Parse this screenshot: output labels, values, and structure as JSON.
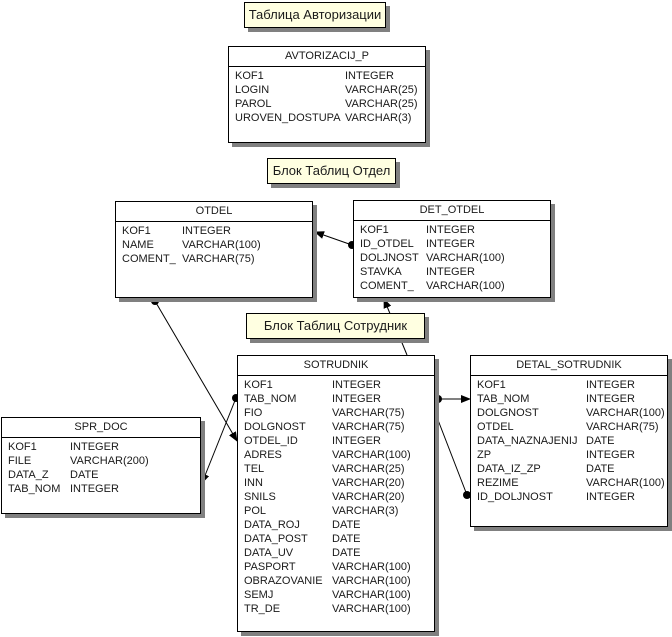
{
  "notes": {
    "auth": "Таблица Авторизации",
    "otdel": "Блок Таблиц Отдел",
    "sotrudnik": "Блок Таблиц Сотрудник"
  },
  "entities": {
    "avtorizacij_p": {
      "name": "AVTORIZACIJ_P",
      "columns": [
        {
          "name": "KOF1",
          "type": "INTEGER"
        },
        {
          "name": "LOGIN",
          "type": "VARCHAR(25)"
        },
        {
          "name": "PAROL",
          "type": "VARCHAR(25)"
        },
        {
          "name": "UROVEN_DOSTUPA",
          "type": "VARCHAR(3)"
        }
      ]
    },
    "otdel": {
      "name": "OTDEL",
      "columns": [
        {
          "name": "KOF1",
          "type": "INTEGER"
        },
        {
          "name": "NAME",
          "type": "VARCHAR(100)"
        },
        {
          "name": "COMENT_",
          "type": "VARCHAR(75)"
        }
      ]
    },
    "det_otdel": {
      "name": "DET_OTDEL",
      "columns": [
        {
          "name": "KOF1",
          "type": "INTEGER"
        },
        {
          "name": "ID_OTDEL",
          "type": "INTEGER"
        },
        {
          "name": "DOLJNOST",
          "type": "VARCHAR(100)"
        },
        {
          "name": "STAVKA",
          "type": "INTEGER"
        },
        {
          "name": "COMENT_",
          "type": "VARCHAR(100)"
        }
      ]
    },
    "sotrudnik": {
      "name": "SOTRUDNIK",
      "columns": [
        {
          "name": "KOF1",
          "type": "INTEGER"
        },
        {
          "name": "TAB_NOM",
          "type": "INTEGER"
        },
        {
          "name": "FIO",
          "type": "VARCHAR(75)"
        },
        {
          "name": "DOLGNOST",
          "type": "VARCHAR(75)"
        },
        {
          "name": "OTDEL_ID",
          "type": "INTEGER"
        },
        {
          "name": "ADRES",
          "type": "VARCHAR(100)"
        },
        {
          "name": "TEL",
          "type": "VARCHAR(25)"
        },
        {
          "name": "INN",
          "type": "VARCHAR(20)"
        },
        {
          "name": "SNILS",
          "type": "VARCHAR(20)"
        },
        {
          "name": "POL",
          "type": "VARCHAR(3)"
        },
        {
          "name": "DATA_ROJ",
          "type": "DATE"
        },
        {
          "name": "DATA_POST",
          "type": "DATE"
        },
        {
          "name": "DATA_UV",
          "type": "DATE"
        },
        {
          "name": "PASPORT",
          "type": "VARCHAR(100)"
        },
        {
          "name": "OBRAZOVANIE",
          "type": "VARCHAR(100)"
        },
        {
          "name": "SEMJ",
          "type": "VARCHAR(100)"
        },
        {
          "name": "TR_DE",
          "type": "VARCHAR(100)"
        }
      ]
    },
    "detal_sotrudnik": {
      "name": "DETAL_SOTRUDNIK",
      "columns": [
        {
          "name": "KOF1",
          "type": "INTEGER"
        },
        {
          "name": "TAB_NOM",
          "type": "INTEGER"
        },
        {
          "name": "DOLGNOST",
          "type": "VARCHAR(100)"
        },
        {
          "name": "OTDEL",
          "type": "VARCHAR(75)"
        },
        {
          "name": "DATA_NAZNAJENIJ",
          "type": "DATE"
        },
        {
          "name": "ZP",
          "type": "INTEGER"
        },
        {
          "name": "DATA_IZ_ZP",
          "type": "DATE"
        },
        {
          "name": "REZIME",
          "type": "VARCHAR(100)"
        },
        {
          "name": "ID_DOLJNOST",
          "type": "INTEGER"
        }
      ]
    },
    "spr_doc": {
      "name": "SPR_DOC",
      "columns": [
        {
          "name": "KOF1",
          "type": "INTEGER"
        },
        {
          "name": "FILE",
          "type": "VARCHAR(200)"
        },
        {
          "name": "DATA_Z",
          "type": "DATE"
        },
        {
          "name": "TAB_NOM",
          "type": "INTEGER"
        }
      ]
    }
  },
  "relationships": [
    {
      "from": "det_otdel",
      "from_column": "ID_OTDEL",
      "to": "otdel"
    },
    {
      "from": "sotrudnik",
      "from_column": "OTDEL_ID",
      "to": "otdel"
    },
    {
      "from": "sotrudnik",
      "from_column": "TAB_NOM",
      "to": "spr_doc"
    },
    {
      "from": "sotrudnik",
      "from_column": "DOLGNOST",
      "to": "det_otdel"
    },
    {
      "from": "sotrudnik",
      "from_column": "TAB_NOM",
      "to": "detal_sotrudnik",
      "to_column": "TAB_NOM"
    },
    {
      "from": "sotrudnik",
      "to": "detal_sotrudnik",
      "to_column": "ID_DOLJNOST"
    }
  ]
}
